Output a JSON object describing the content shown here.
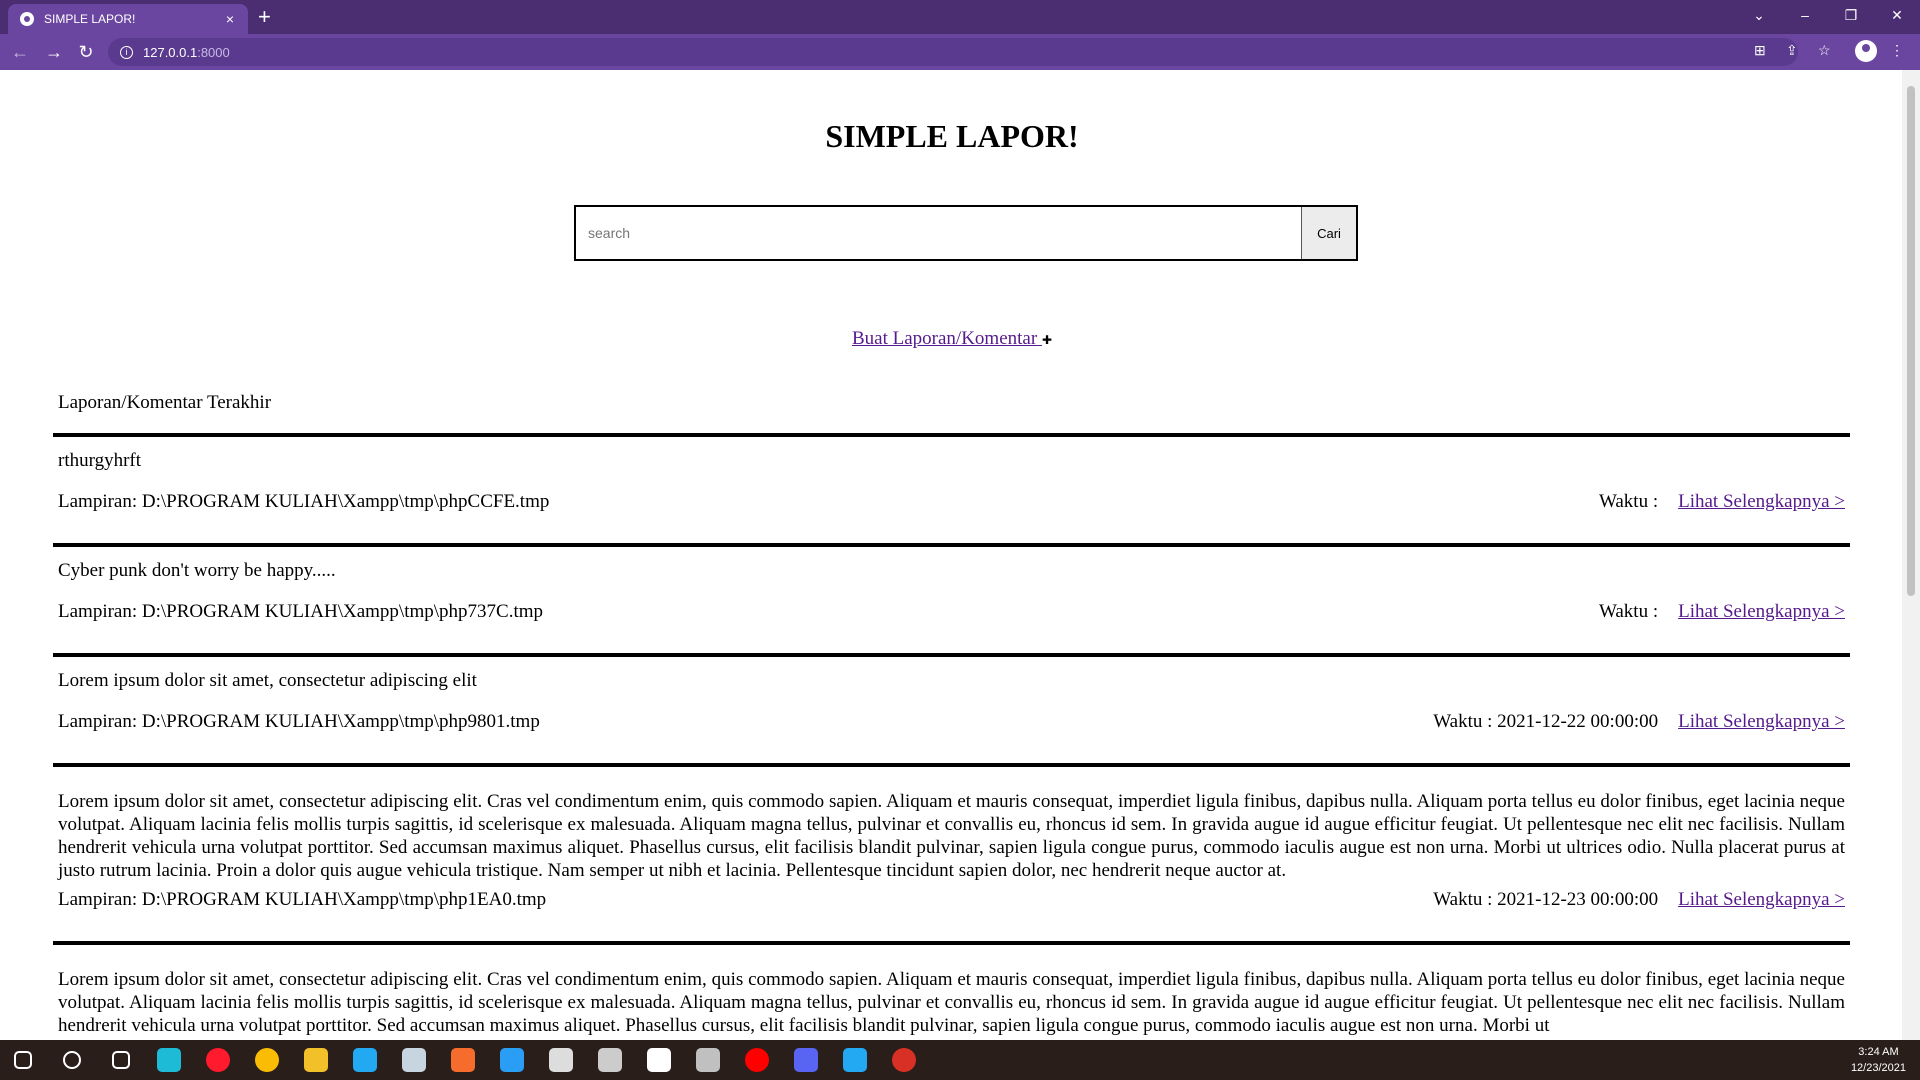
{
  "browser": {
    "tab_title": "SIMPLE LAPOR!",
    "tab_close": "×",
    "new_tab": "+",
    "url_host": "127.0.0.1",
    "url_port": ":8000",
    "window_controls": [
      "⌄",
      "–",
      "❐",
      "✕"
    ]
  },
  "page": {
    "title": "SIMPLE LAPOR!",
    "search_placeholder": "search",
    "search_button": "Cari",
    "new_post_link": "Buat Laporan/Komentar",
    "new_post_icon": "✚",
    "section_title": "Laporan/Komentar Terakhir",
    "posts": [
      {
        "body": "rthurgyhrft",
        "attachment": "Lampiran: D:\\PROGRAM KULIAH\\Xampp\\tmp\\phpCCFE.tmp",
        "time": "Waktu :",
        "link": "Lihat Selengkapnya >"
      },
      {
        "body": "Cyber punk don't worry be happy.....",
        "attachment": "Lampiran: D:\\PROGRAM KULIAH\\Xampp\\tmp\\php737C.tmp",
        "time": "Waktu :",
        "link": "Lihat Selengkapnya >"
      },
      {
        "body": "Lorem ipsum dolor sit amet, consectetur adipiscing elit",
        "attachment": "Lampiran: D:\\PROGRAM KULIAH\\Xampp\\tmp\\php9801.tmp",
        "time": "Waktu : 2021-12-22 00:00:00",
        "link": "Lihat Selengkapnya >"
      },
      {
        "body": "Lorem ipsum dolor sit amet, consectetur adipiscing elit. Cras vel condimentum enim, quis commodo sapien. Aliquam et mauris consequat, imperdiet ligula finibus, dapibus nulla. Aliquam porta tellus eu dolor finibus, eget lacinia neque volutpat. Aliquam lacinia felis mollis turpis sagittis, id scelerisque ex malesuada. Aliquam magna tellus, pulvinar et convallis eu, rhoncus id sem. In gravida augue id augue efficitur feugiat. Ut pellentesque nec elit nec facilisis. Nullam hendrerit vehicula urna volutpat porttitor. Sed accumsan maximus aliquet. Phasellus cursus, elit facilisis blandit pulvinar, sapien ligula congue purus, commodo iaculis augue est non urna. Morbi ut ultrices odio. Nulla placerat purus at justo rutrum lacinia. Proin a dolor quis augue vehicula tristique. Nam semper ut nibh et lacinia. Pellentesque tincidunt sapien dolor, nec hendrerit neque auctor at.",
        "attachment": "Lampiran: D:\\PROGRAM KULIAH\\Xampp\\tmp\\php1EA0.tmp",
        "time": "Waktu : 2021-12-23 00:00:00",
        "link": "Lihat Selengkapnya >"
      },
      {
        "body": "Lorem ipsum dolor sit amet, consectetur adipiscing elit. Cras vel condimentum enim, quis commodo sapien. Aliquam et mauris consequat, imperdiet ligula finibus, dapibus nulla. Aliquam porta tellus eu dolor finibus, eget lacinia neque volutpat. Aliquam lacinia felis mollis turpis sagittis, id scelerisque ex malesuada. Aliquam magna tellus, pulvinar et convallis eu, rhoncus id sem. In gravida augue id augue efficitur feugiat. Ut pellentesque nec elit nec facilisis. Nullam hendrerit vehicula urna volutpat porttitor. Sed accumsan maximus aliquet. Phasellus cursus, elit facilisis blandit pulvinar, sapien ligula congue purus, commodo iaculis augue est non urna. Morbi ut"
      }
    ]
  },
  "taskbar": {
    "time": "3:24 AM",
    "date": "12/23/2021",
    "apps": [
      {
        "icon": "start-icon",
        "color": "#ffffff"
      },
      {
        "icon": "search-icon",
        "color": "#ffffff"
      },
      {
        "icon": "task-view-icon",
        "color": "#ffffff"
      },
      {
        "icon": "edge-icon",
        "color": "#1ebbd7"
      },
      {
        "icon": "opera-icon",
        "color": "#ff1b2d"
      },
      {
        "icon": "chrome-icon",
        "color": "#fbbc05"
      },
      {
        "icon": "file-explorer-icon",
        "color": "#f2c029"
      },
      {
        "icon": "vscode-icon",
        "color": "#23a9f2"
      },
      {
        "icon": "steam-icon",
        "color": "#c7d5e0"
      },
      {
        "icon": "origin-icon",
        "color": "#f56c2d"
      },
      {
        "icon": "ubisoft-icon",
        "color": "#2a9df4"
      },
      {
        "icon": "epic-games-icon",
        "color": "#dddddd"
      },
      {
        "icon": "obs-icon",
        "color": "#cccccc"
      },
      {
        "icon": "logitech-icon",
        "color": "#ffffff"
      },
      {
        "icon": "game-app-icon",
        "color": "#c0c0c0"
      },
      {
        "icon": "youtube-music-icon",
        "color": "#ff0000"
      },
      {
        "icon": "discord-icon",
        "color": "#5865f2"
      },
      {
        "icon": "vscode-active-icon",
        "color": "#23a9f2"
      },
      {
        "icon": "chrome-profile-icon",
        "color": "#d93025"
      }
    ]
  }
}
